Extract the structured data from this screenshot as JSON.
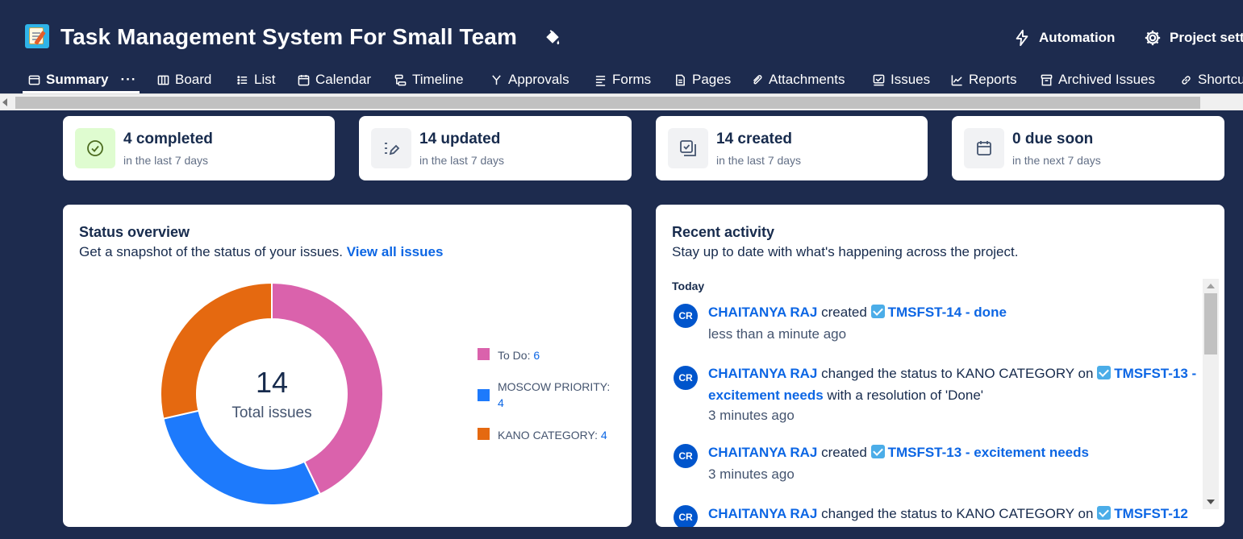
{
  "header": {
    "title": "Task Management System For Small Team",
    "automation_label": "Automation",
    "settings_label": "Project sett"
  },
  "tabs": [
    {
      "label": "Summary"
    },
    {
      "label": "Board"
    },
    {
      "label": "List"
    },
    {
      "label": "Calendar"
    },
    {
      "label": "Timeline"
    },
    {
      "label": "Approvals"
    },
    {
      "label": "Forms"
    },
    {
      "label": "Pages"
    },
    {
      "label": "Attachments"
    },
    {
      "label": "Issues"
    },
    {
      "label": "Reports"
    },
    {
      "label": "Archived Issues"
    },
    {
      "label": "Shortcu"
    }
  ],
  "stats": [
    {
      "main": "4 completed",
      "sub": "in the last 7 days",
      "icon": "check-circle-icon"
    },
    {
      "main": "14 updated",
      "sub": "in the last 7 days",
      "icon": "edit-list-icon"
    },
    {
      "main": "14 created",
      "sub": "in the last 7 days",
      "icon": "create-issue-icon"
    },
    {
      "main": "0 due soon",
      "sub": "in the next 7 days",
      "icon": "calendar-icon"
    }
  ],
  "status_overview": {
    "title": "Status overview",
    "description": "Get a snapshot of the status of your issues.",
    "link": "View all issues",
    "total": "14",
    "total_label": "Total issues",
    "legend": [
      {
        "label": "To Do:",
        "count": "6",
        "color": "#da62ac"
      },
      {
        "label": "MOSCOW PRIORITY:",
        "count": "4",
        "color": "#1d7afc"
      },
      {
        "label": "KANO CATEGORY:",
        "count": "4",
        "color": "#e56910"
      }
    ]
  },
  "chart_data": {
    "type": "pie",
    "categories": [
      "To Do",
      "MOSCOW PRIORITY",
      "KANO CATEGORY"
    ],
    "values": [
      6,
      4,
      4
    ],
    "colors": [
      "#da62ac",
      "#1d7afc",
      "#e56910"
    ],
    "title": "Status overview",
    "center_text": "14",
    "center_label": "Total issues",
    "legend_position": "right"
  },
  "recent_activity": {
    "title": "Recent activity",
    "description": "Stay up to date with what's happening across the project.",
    "group_label": "Today",
    "items": [
      {
        "avatar": "CR",
        "user": "CHAITANYA RAJ",
        "action": "created",
        "issue": "TMSFST-14 - done",
        "suffix": "",
        "time": "less than a minute ago"
      },
      {
        "avatar": "CR",
        "user": "CHAITANYA RAJ",
        "action": "changed the status to KANO CATEGORY on",
        "issue": "TMSFST-13 - excitement needs",
        "suffix": "with a resolution of 'Done'",
        "time": "3 minutes ago"
      },
      {
        "avatar": "CR",
        "user": "CHAITANYA RAJ",
        "action": "created",
        "issue": "TMSFST-13 - excitement needs",
        "suffix": "",
        "time": "3 minutes ago"
      },
      {
        "avatar": "CR",
        "user": "CHAITANYA RAJ",
        "action": "changed the status to KANO CATEGORY on",
        "issue": "TMSFST-12",
        "suffix": "",
        "time": ""
      }
    ]
  }
}
